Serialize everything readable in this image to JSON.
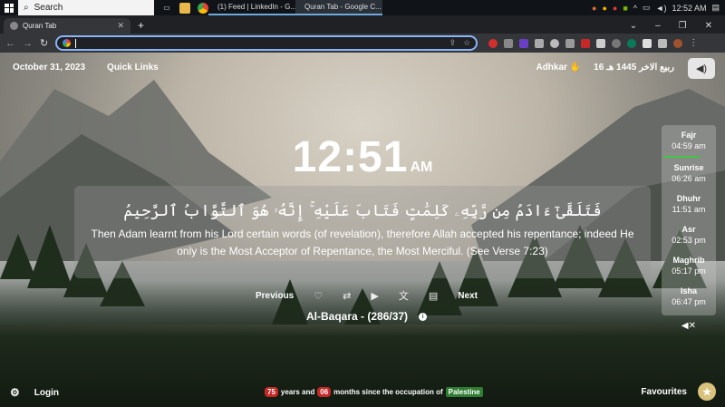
{
  "taskbar": {
    "search_label": "Search",
    "apps": [
      {
        "label": "(1) Feed | LinkedIn - G..."
      },
      {
        "label": "Quran Tab - Google C..."
      }
    ],
    "time": "12:52 AM"
  },
  "browser": {
    "tab_title": "Quran Tab",
    "address_value": ""
  },
  "header": {
    "date": "October 31, 2023",
    "quick_links": "Quick Links",
    "adhkar": "Adhkar",
    "hijri_date": "16 ربيع الاخر 1445 هـ"
  },
  "clock": {
    "time": "12:51",
    "ampm": "AM"
  },
  "verse": {
    "arabic": "فَتَلَقَّىٰٓ ءَادَمُ مِن رَّبِّهِۦ كَلِمَٰتٍ فَتَابَ عَلَيْهِ ۚ إِنَّهُۥ هُوَ ٱلتَّوَّابُ ٱلرَّحِيمُ",
    "translation": "Then Adam learnt from his Lord certain words (of revelation), therefore Allah accepted his repentance; indeed He only is the Most Acceptor of Repentance, the Most Merciful. (See Verse 7:23)"
  },
  "controls": {
    "previous": "Previous",
    "next": "Next"
  },
  "surah": {
    "label": "Al-Baqara - (286/37)"
  },
  "prayers": [
    {
      "name": "Fajr",
      "time": "04:59 am"
    },
    {
      "name": "Sunrise",
      "time": "06:26 am"
    },
    {
      "name": "Dhuhr",
      "time": "11:51 am"
    },
    {
      "name": "Asr",
      "time": "02:53 pm"
    },
    {
      "name": "Maghrib",
      "time": "05:17 pm"
    },
    {
      "name": "Isha",
      "time": "06:47 pm"
    }
  ],
  "footer": {
    "login": "Login",
    "years": "75",
    "years_text": "years and",
    "months": "06",
    "months_text": "months since the occupation of",
    "place": "Palestine",
    "favourites": "Favourites"
  }
}
